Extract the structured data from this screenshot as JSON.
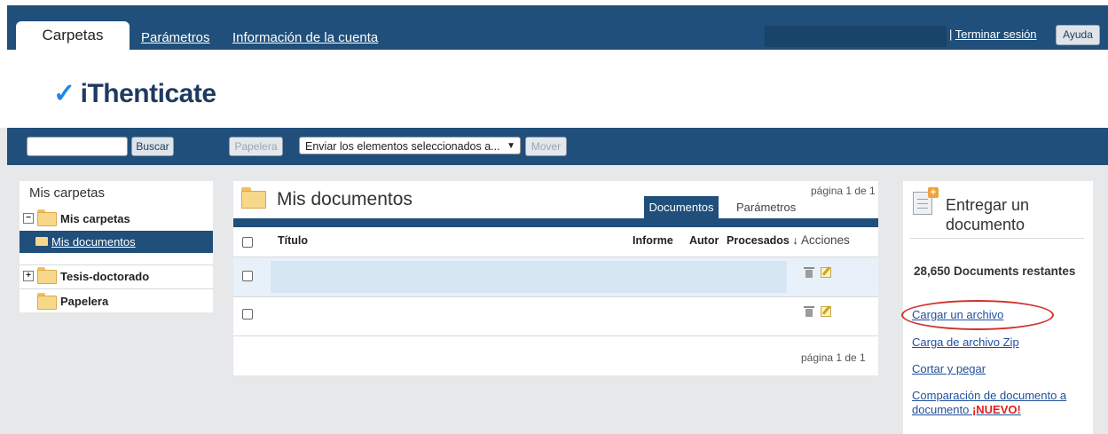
{
  "header": {
    "tabs": [
      {
        "label": "Carpetas",
        "active": true
      },
      {
        "label": "Parámetros",
        "active": false
      },
      {
        "label": "Información de la cuenta",
        "active": false
      }
    ],
    "separator": "|",
    "logout_label": "Terminar sesión",
    "help_label": "Ayuda"
  },
  "logo": {
    "text": "iThenticate",
    "mark": "✓"
  },
  "toolbar": {
    "search_value": "",
    "search_button": "Buscar",
    "trash_button": "Papelera",
    "move_select": "Enviar los elementos seleccionados a...",
    "move_button": "Mover"
  },
  "folders": {
    "title": "Mis carpetas",
    "items": [
      {
        "label": "Mis carpetas",
        "toggle": "−"
      },
      {
        "label": "Mis documentos",
        "selected": true
      },
      {
        "label": "Tesis-doctorado",
        "toggle": "+"
      },
      {
        "label": "Papelera"
      }
    ]
  },
  "documents": {
    "title": "Mis documentos",
    "pager": "página 1 de 1",
    "tabs": [
      "Documentos",
      "Parámetros"
    ],
    "columns": [
      "Título",
      "Informe",
      "Autor",
      "Procesados ↓",
      "Acciones"
    ],
    "rows": [
      {
        "title": "",
        "informe": "",
        "autor": "",
        "procesados": ""
      },
      {
        "title": "",
        "informe": "",
        "autor": "",
        "procesados": ""
      }
    ]
  },
  "submit": {
    "title": "Entregar un documento",
    "remaining": "28,650 Documents restantes",
    "links": [
      "Cargar un archivo",
      "Carga de archivo Zip",
      "Cortar y pegar",
      "Comparación de documento a documento"
    ],
    "new_badge": "¡NUEVO!"
  },
  "colors": {
    "brand_navy": "#1f4f7a",
    "link_blue": "#1f4f9c",
    "highlight_red": "#d0302a",
    "logo_check": "#1e88e5"
  }
}
